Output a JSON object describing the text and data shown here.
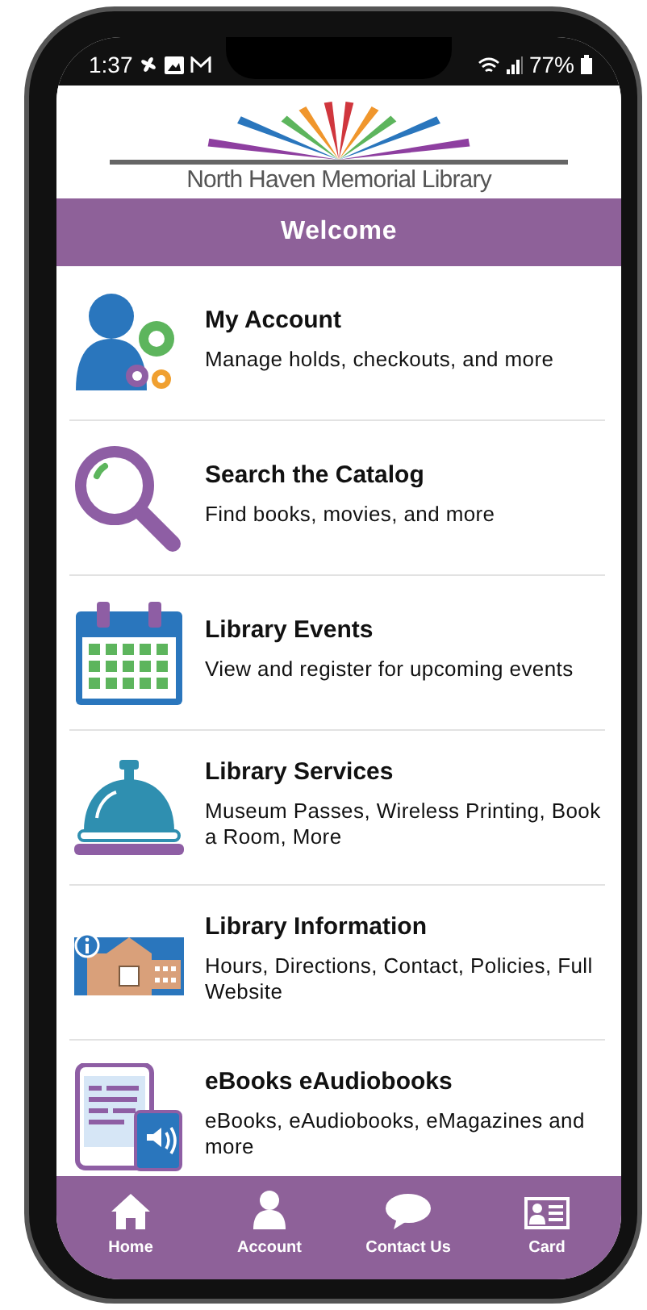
{
  "status_bar": {
    "time": "1:37",
    "battery": "77%"
  },
  "header": {
    "library_name": "North Haven Memorial Library"
  },
  "title_bar": {
    "title": "Welcome"
  },
  "menu_items": [
    {
      "kind": "account",
      "title": "My Account",
      "description": "Manage holds, checkouts, and more"
    },
    {
      "kind": "search",
      "title": "Search the Catalog",
      "description": "Find books, movies, and more"
    },
    {
      "kind": "events",
      "title": "Library Events",
      "description": "View and register for upcoming events"
    },
    {
      "kind": "services",
      "title": "Library Services",
      "description": "Museum Passes, Wireless Printing, Book a Room, More"
    },
    {
      "kind": "info",
      "title": "Library Information",
      "description": "Hours, Directions, Contact, Policies, Full Website"
    },
    {
      "kind": "ebooks",
      "title": "eBooks eAudiobooks",
      "description": "eBooks, eAudiobooks, eMagazines and more"
    }
  ],
  "tab_bar": [
    {
      "kind": "home",
      "label": "Home"
    },
    {
      "kind": "account",
      "label": "Account"
    },
    {
      "kind": "chat",
      "label": "Contact Us"
    },
    {
      "kind": "card",
      "label": "Card"
    }
  ]
}
